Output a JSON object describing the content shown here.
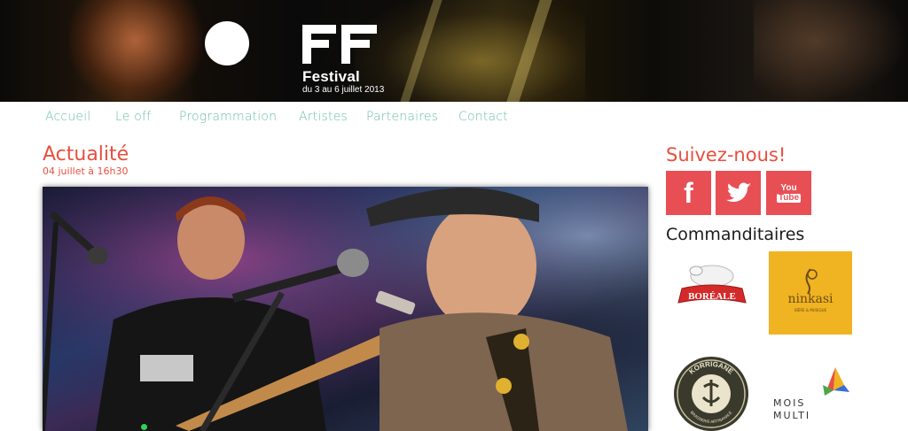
{
  "header": {
    "logo_mark": "FF",
    "brand_name": "Festival",
    "dates": "du 3 au 6 juillet 2013"
  },
  "nav": {
    "items": [
      {
        "label": "Accueil"
      },
      {
        "label": "Le off"
      },
      {
        "label": "Programmation"
      },
      {
        "label": "Artistes"
      },
      {
        "label": "Partenaires"
      },
      {
        "label": "Contact"
      }
    ]
  },
  "main": {
    "title": "Actualité",
    "date": "04 juillet à 16h30"
  },
  "sidebar": {
    "follow_title": "Suivez-nous!",
    "social": {
      "facebook": "f",
      "youtube_line1": "You",
      "youtube_line2": "Tube"
    },
    "sponsors_title": "Commanditaires",
    "sponsors": {
      "boreale": "BORÉALE",
      "ninkasi": "ninkasi",
      "ninkasi_sub": "BIÈRE & MUSIQUE",
      "korrigane": "KORRIGANE",
      "korrigane_sub": "BRASSERIE ARTISANALE",
      "mois_line1": "MOIS",
      "mois_line2": "MULTI"
    }
  },
  "colors": {
    "accent_red": "#e84f3f",
    "nav_green": "#6bbfa5",
    "social_bg": "#e84f55",
    "ninkasi_yellow": "#f0b322"
  }
}
